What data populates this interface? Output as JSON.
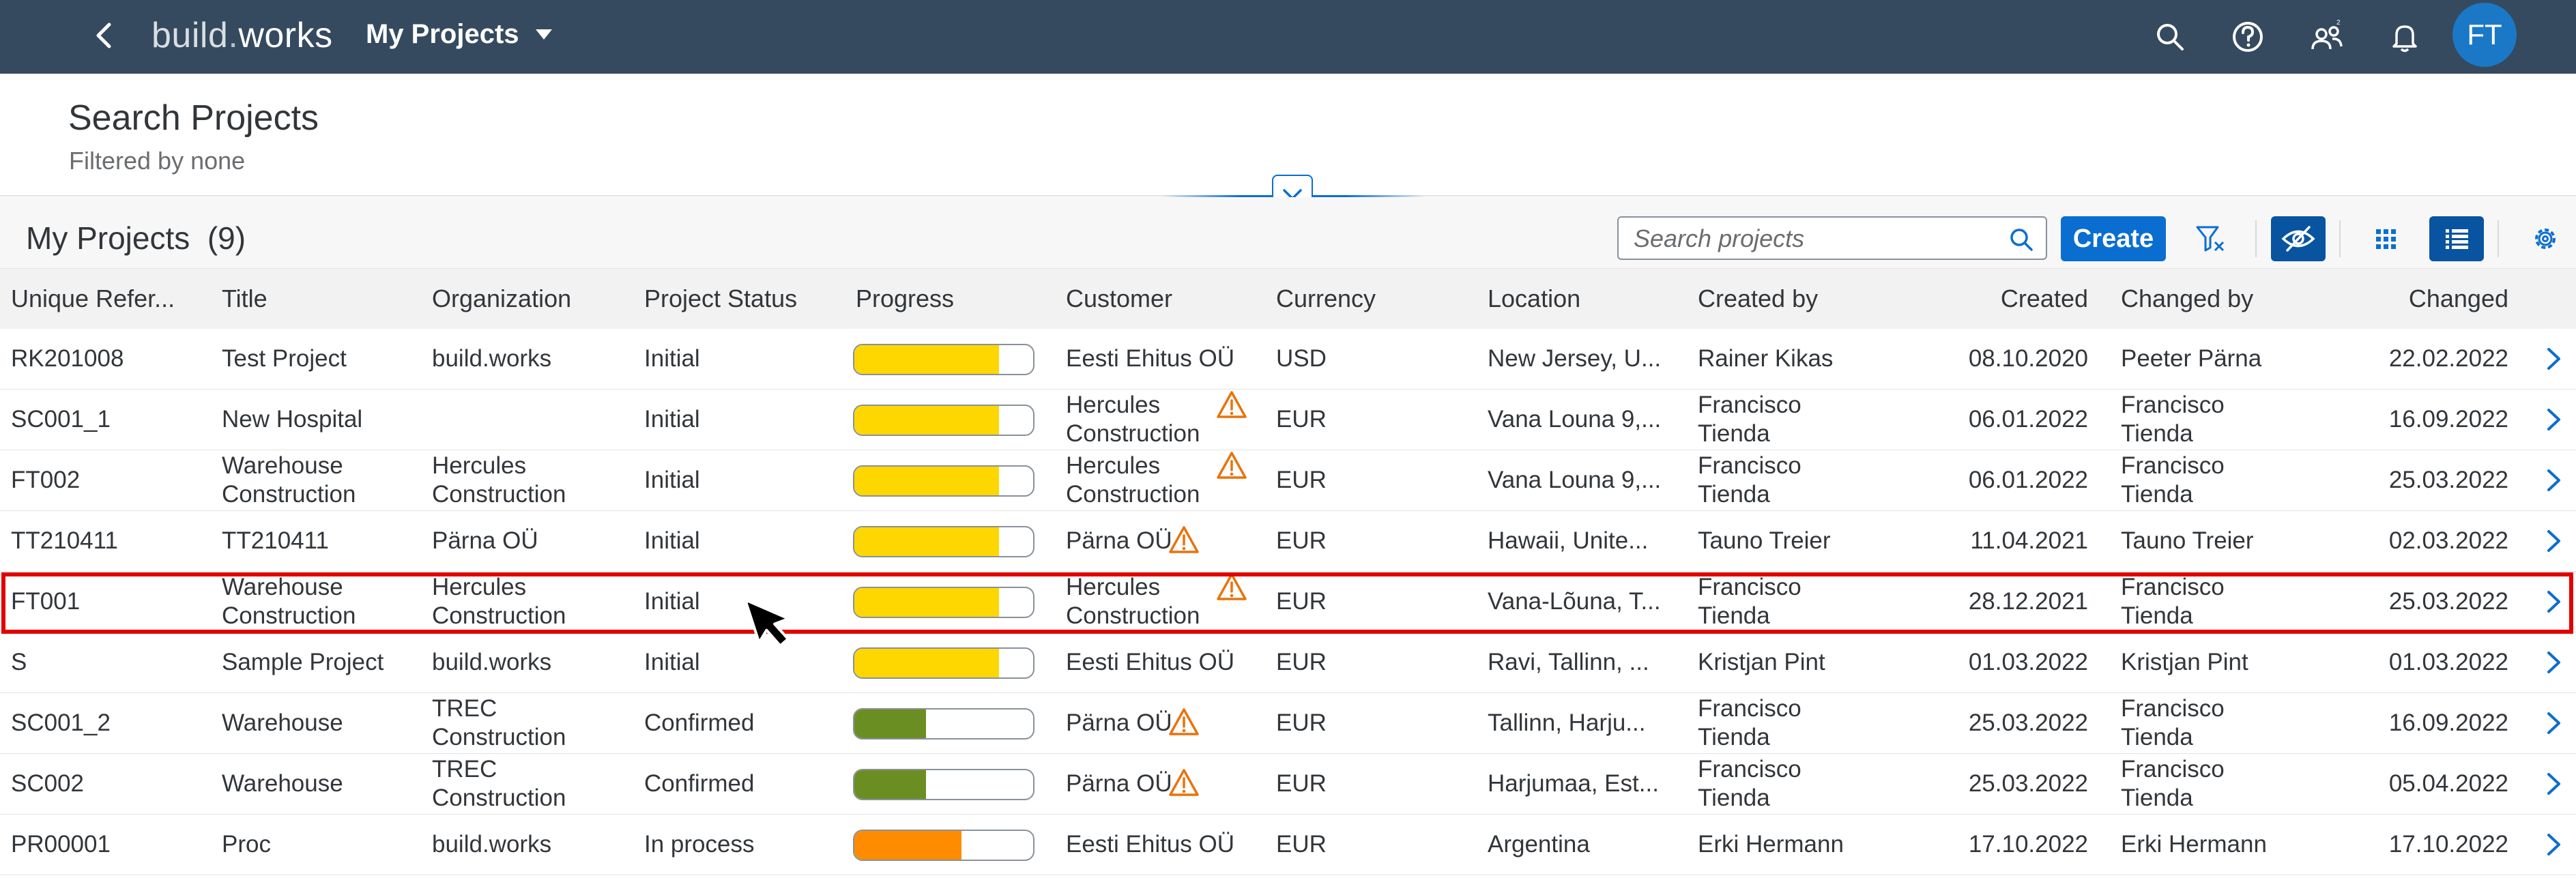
{
  "shell": {
    "logo_part1": "build",
    "logo_dot": ".",
    "logo_part2": "works",
    "app_title": "My Projects",
    "avatar_initials": "FT"
  },
  "header": {
    "title": "Search Projects",
    "subtitle": "Filtered by none"
  },
  "toolbar": {
    "title": "My Projects",
    "count": "(9)",
    "search_placeholder": "Search projects",
    "create_label": "Create"
  },
  "columns": [
    "Unique Refer...",
    "Title",
    "Organization",
    "Project Status",
    "Progress",
    "Customer",
    "Currency",
    "Location",
    "Created by",
    "Created",
    "Changed by",
    "Changed"
  ],
  "rows": [
    {
      "ref": "RK201008",
      "title": [
        "Test Project"
      ],
      "org": [
        "build.works"
      ],
      "status": "Initial",
      "progress": 0.81,
      "progress_color": "#ffd700",
      "customer": [
        "Eesti Ehitus OÜ"
      ],
      "customer_warn": false,
      "currency": "USD",
      "location": "New Jersey, U...",
      "created_by": [
        "Rainer Kikas"
      ],
      "created": "08.10.2020",
      "changed_by": [
        "Peeter Pärna"
      ],
      "changed": "22.02.2022"
    },
    {
      "ref": "SC001_1",
      "title": [
        "New Hospital"
      ],
      "org": [],
      "status": "Initial",
      "progress": 0.81,
      "progress_color": "#ffd700",
      "customer": [
        "Hercules",
        "Construction"
      ],
      "customer_warn": true,
      "currency": "EUR",
      "location": "Vana Louna 9,...",
      "created_by": [
        "Francisco",
        "Tienda"
      ],
      "created": "06.01.2022",
      "changed_by": [
        "Francisco",
        "Tienda"
      ],
      "changed": "16.09.2022"
    },
    {
      "ref": "FT002",
      "title": [
        "Warehouse",
        "Construction"
      ],
      "org": [
        "Hercules",
        "Construction"
      ],
      "status": "Initial",
      "progress": 0.81,
      "progress_color": "#ffd700",
      "customer": [
        "Hercules",
        "Construction"
      ],
      "customer_warn": true,
      "currency": "EUR",
      "location": "Vana Louna 9,...",
      "created_by": [
        "Francisco",
        "Tienda"
      ],
      "created": "06.01.2022",
      "changed_by": [
        "Francisco",
        "Tienda"
      ],
      "changed": "25.03.2022"
    },
    {
      "ref": "TT210411",
      "title": [
        "TT210411"
      ],
      "org": [
        "Pärna OÜ"
      ],
      "status": "Initial",
      "progress": 0.81,
      "progress_color": "#ffd700",
      "customer": [
        "Pärna OÜ"
      ],
      "customer_warn": true,
      "currency": "EUR",
      "location": "Hawaii, Unite...",
      "created_by": [
        "Tauno Treier"
      ],
      "created": "11.04.2021",
      "changed_by": [
        "Tauno Treier"
      ],
      "changed": "02.03.2022"
    },
    {
      "ref": "FT001",
      "title": [
        "Warehouse",
        "Construction"
      ],
      "org": [
        "Hercules",
        "Construction"
      ],
      "status": "Initial",
      "progress": 0.81,
      "progress_color": "#ffd700",
      "customer": [
        "Hercules",
        "Construction"
      ],
      "customer_warn": true,
      "currency": "EUR",
      "location": "Vana-Lõuna, T...",
      "created_by": [
        "Francisco",
        "Tienda"
      ],
      "created": "28.12.2021",
      "changed_by": [
        "Francisco",
        "Tienda"
      ],
      "changed": "25.03.2022"
    },
    {
      "ref": "S",
      "title": [
        "Sample Project"
      ],
      "org": [
        "build.works"
      ],
      "status": "Initial",
      "progress": 0.81,
      "progress_color": "#ffd700",
      "customer": [
        "Eesti Ehitus OÜ"
      ],
      "customer_warn": false,
      "currency": "EUR",
      "location": "Ravi, Tallinn, ...",
      "created_by": [
        "Kristjan Pint"
      ],
      "created": "01.03.2022",
      "changed_by": [
        "Kristjan Pint"
      ],
      "changed": "01.03.2022"
    },
    {
      "ref": "SC001_2",
      "title": [
        "Warehouse"
      ],
      "org": [
        "TREC",
        "Construction"
      ],
      "status": "Confirmed",
      "progress": 0.4,
      "progress_color": "#6b8e23",
      "customer": [
        "Pärna OÜ"
      ],
      "customer_warn": true,
      "currency": "EUR",
      "location": "Tallinn, Harju...",
      "created_by": [
        "Francisco",
        "Tienda"
      ],
      "created": "25.03.2022",
      "changed_by": [
        "Francisco",
        "Tienda"
      ],
      "changed": "16.09.2022"
    },
    {
      "ref": "SC002",
      "title": [
        "Warehouse"
      ],
      "org": [
        "TREC",
        "Construction"
      ],
      "status": "Confirmed",
      "progress": 0.4,
      "progress_color": "#6b8e23",
      "customer": [
        "Pärna OÜ"
      ],
      "customer_warn": true,
      "currency": "EUR",
      "location": "Harjumaa, Est...",
      "created_by": [
        "Francisco",
        "Tienda"
      ],
      "created": "25.03.2022",
      "changed_by": [
        "Francisco",
        "Tienda"
      ],
      "changed": "05.04.2022"
    },
    {
      "ref": "PR00001",
      "title": [
        "Proc"
      ],
      "org": [
        "build.works"
      ],
      "status": "In process",
      "progress": 0.6,
      "progress_color": "#ff8c00",
      "customer": [
        "Eesti Ehitus OÜ"
      ],
      "customer_warn": false,
      "currency": "EUR",
      "location": "Argentina",
      "created_by": [
        "Erki Hermann"
      ],
      "created": "17.10.2022",
      "changed_by": [
        "Erki Hermann"
      ],
      "changed": "17.10.2022"
    }
  ],
  "selected_row_ref": "FT001",
  "colors": {
    "shell_bg": "#354a5f",
    "accent": "#0a6ed1",
    "warning": "#e9730c",
    "selection_border": "#e00000"
  },
  "icons": {
    "back": "back-arrow-icon",
    "caret": "caret-down-icon",
    "search": "search-icon",
    "help": "help-icon",
    "users": "users-icon",
    "bell": "notification-bell-icon",
    "collapse": "chevron-down-icon",
    "clear_filter": "clear-filter-icon",
    "hide": "hide-icon",
    "grid": "grid-view-icon",
    "list": "list-view-icon",
    "settings": "gear-icon",
    "warning": "warning-triangle-icon",
    "nav": "chevron-right-icon"
  }
}
